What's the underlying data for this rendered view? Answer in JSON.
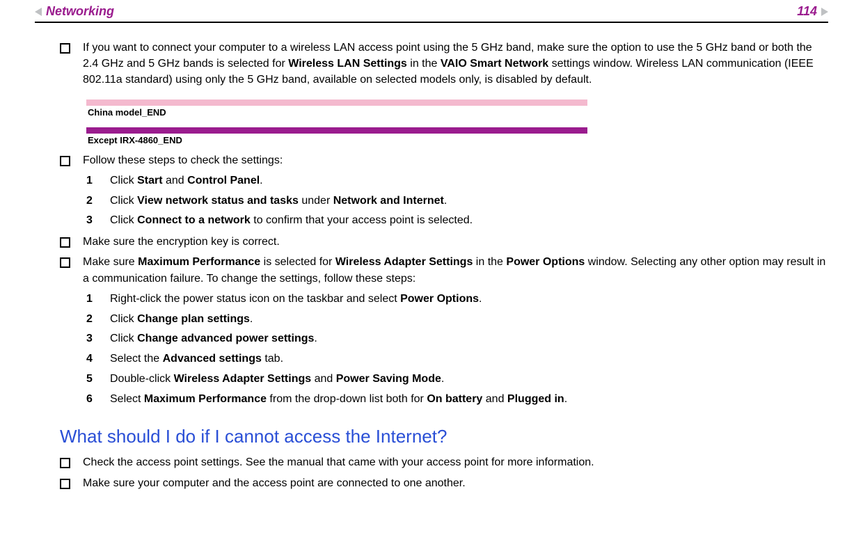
{
  "header": {
    "title": "Networking",
    "page_number": "114"
  },
  "bullets": {
    "b1_pre": "If you want to connect your computer to a wireless LAN access point using the 5 GHz band, make sure the option to use the 5 GHz band or both the 2.4 GHz and 5 GHz bands is selected for ",
    "b1_bold1": "Wireless LAN Settings",
    "b1_mid1": " in the ",
    "b1_bold2": "VAIO Smart Network",
    "b1_post": " settings window. Wireless LAN communication (IEEE 802.11a standard) using only the 5 GHz band, available on selected models only, is disabled by default.",
    "b2": "Follow these steps to check the settings:",
    "b3": "Make sure the encryption key is correct.",
    "b4_pre": "Make sure ",
    "b4_bold1": "Maximum Performance",
    "b4_mid1": " is selected for ",
    "b4_bold2": "Wireless Adapter Settings",
    "b4_mid2": " in the ",
    "b4_bold3": "Power Options",
    "b4_post": " window. Selecting any other option may result in a communication failure. To change the settings, follow these steps:",
    "b5": "Check the access point settings. See the manual that came with your access point for more information.",
    "b6": "Make sure your computer and the access point are connected to one another."
  },
  "tags": {
    "t1": "China model_END",
    "t2": "Except IRX-4860_END"
  },
  "stepsA": {
    "n1": "1",
    "s1_pre": "Click ",
    "s1_b1": "Start",
    "s1_mid": " and ",
    "s1_b2": "Control Panel",
    "s1_post": ".",
    "n2": "2",
    "s2_pre": "Click ",
    "s2_b1": "View network status and tasks",
    "s2_mid": " under ",
    "s2_b2": "Network and Internet",
    "s2_post": ".",
    "n3": "3",
    "s3_pre": "Click ",
    "s3_b1": "Connect to a network",
    "s3_post": " to confirm that your access point is selected."
  },
  "stepsB": {
    "n1": "1",
    "s1_pre": "Right-click the power status icon on the taskbar and select ",
    "s1_b1": "Power Options",
    "s1_post": ".",
    "n2": "2",
    "s2_pre": "Click ",
    "s2_b1": "Change plan settings",
    "s2_post": ".",
    "n3": "3",
    "s3_pre": "Click ",
    "s3_b1": "Change advanced power settings",
    "s3_post": ".",
    "n4": "4",
    "s4_pre": "Select the ",
    "s4_b1": "Advanced settings",
    "s4_post": " tab.",
    "n5": "5",
    "s5_pre": "Double-click ",
    "s5_b1": "Wireless Adapter Settings",
    "s5_mid": " and ",
    "s5_b2": "Power Saving Mode",
    "s5_post": ".",
    "n6": "6",
    "s6_pre": "Select ",
    "s6_b1": "Maximum Performance",
    "s6_mid1": " from the drop-down list both for ",
    "s6_b2": "On battery",
    "s6_mid2": " and ",
    "s6_b3": "Plugged in",
    "s6_post": "."
  },
  "heading": "What should I do if I cannot access the Internet?"
}
